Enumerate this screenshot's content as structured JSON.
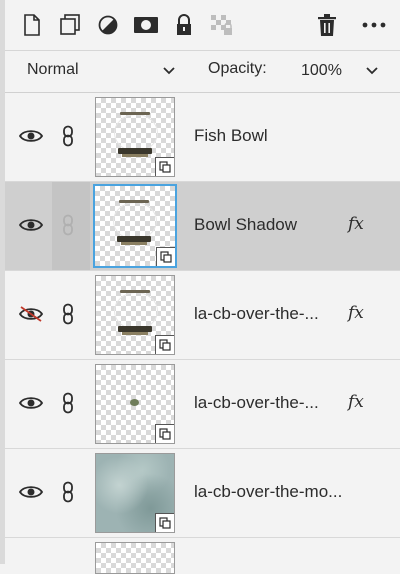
{
  "toolbar": {
    "buttons": [
      {
        "name": "new-layer-button",
        "icon": "new-layer-icon"
      },
      {
        "name": "duplicate-layer-button",
        "icon": "duplicate-layer-icon"
      },
      {
        "name": "adjustment-layer-button",
        "icon": "adjustment-circle-icon"
      },
      {
        "name": "mask-button",
        "icon": "mask-icon"
      },
      {
        "name": "lock-button",
        "icon": "lock-icon"
      },
      {
        "name": "lock-transparency-button",
        "icon": "lock-transparency-icon"
      },
      {
        "name": "delete-layer-button",
        "icon": "trash-icon"
      },
      {
        "name": "more-options-button",
        "icon": "more-dots-icon"
      }
    ]
  },
  "blend": {
    "mode": "Normal",
    "opacity_label": "Opacity:",
    "opacity_value": "100%"
  },
  "layers": [
    {
      "name": "Fish Bowl",
      "visible": true,
      "linked": true,
      "fx": "",
      "selected": false,
      "thumb": "bowl"
    },
    {
      "name": "Bowl Shadow",
      "visible": true,
      "linked": false,
      "fx": "fx",
      "selected": true,
      "thumb": "bowl"
    },
    {
      "name": "la-cb-over-the-...",
      "visible": false,
      "linked": true,
      "fx": "fx",
      "selected": false,
      "thumb": "bowl"
    },
    {
      "name": "la-cb-over-the-...",
      "visible": true,
      "linked": true,
      "fx": "fx",
      "selected": false,
      "thumb": "fish"
    },
    {
      "name": "la-cb-over-the-mo...",
      "visible": true,
      "linked": true,
      "fx": "",
      "selected": false,
      "thumb": "texture"
    }
  ],
  "colors": {
    "selection_border": "#4aa3df",
    "selected_row": "#cfcfcf",
    "hidden_slash": "#c0392b"
  }
}
